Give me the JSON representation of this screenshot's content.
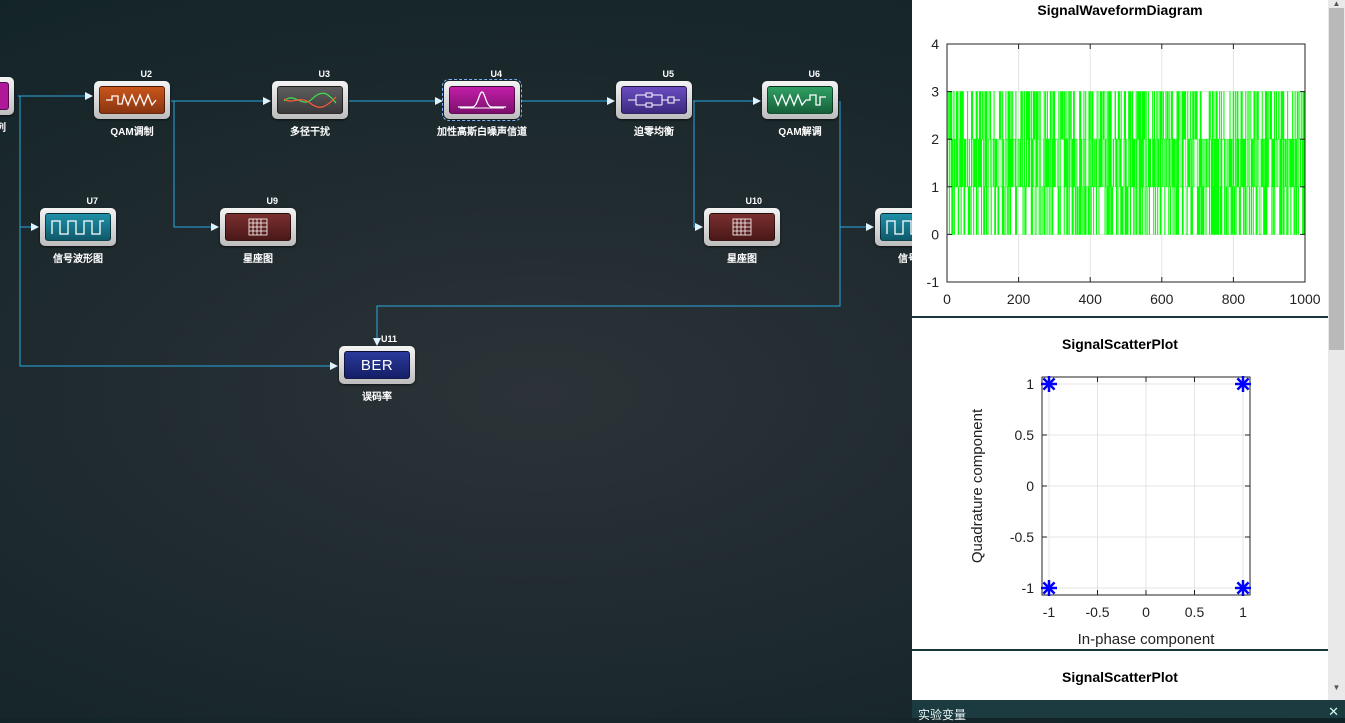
{
  "canvas": {
    "blocks": [
      {
        "id": "U2",
        "label": "QAM调制"
      },
      {
        "id": "U3",
        "label": "多径干扰"
      },
      {
        "id": "U4",
        "label": "加性高斯白噪声信道"
      },
      {
        "id": "U5",
        "label": "迫零均衡"
      },
      {
        "id": "U6",
        "label": "QAM解调"
      },
      {
        "id": "U7",
        "label": "信号波形图"
      },
      {
        "id": "U9",
        "label": "星座图"
      },
      {
        "id": "U10",
        "label": "星座图"
      },
      {
        "id": "U11",
        "label": "误码率",
        "screen_text": "BER"
      }
    ],
    "partial_left_label": "序列",
    "partial_right_label": "信号波"
  },
  "panel": {
    "plot1_title": "SignalWaveformDiagram",
    "plot2_title": "SignalScatterPlot",
    "plot3_title": "SignalScatterPlot"
  },
  "bottom_bar": {
    "title": "实验变量",
    "close_glyph": "✕"
  },
  "colors": {
    "waveform": "#00ff00",
    "scatter": "#0000ff",
    "wire": "#2aa8e0"
  },
  "chart_data": [
    {
      "type": "line",
      "title": "SignalWaveformDiagram",
      "xlabel": "",
      "ylabel": "",
      "xlim": [
        0,
        1000
      ],
      "ylim": [
        -1,
        4
      ],
      "xticks": [
        0,
        200,
        400,
        600,
        800,
        1000
      ],
      "yticks": [
        -1,
        0,
        1,
        2,
        3,
        4
      ],
      "series": [
        {
          "values_description_free": true,
          "levels": [
            0,
            1,
            2,
            3
          ],
          "length": 1000
        }
      ]
    },
    {
      "type": "scatter",
      "title": "SignalScatterPlot",
      "xlabel": "In-phase component",
      "ylabel": "Quadrature component",
      "xlim": [
        -1,
        1
      ],
      "ylim": [
        -1,
        1
      ],
      "xticks": [
        -1,
        -0.5,
        0,
        0.5,
        1
      ],
      "yticks": [
        -1,
        -0.5,
        0,
        0.5,
        1
      ],
      "points": [
        [
          -1,
          1
        ],
        [
          1,
          1
        ],
        [
          -1,
          -1
        ],
        [
          1,
          -1
        ]
      ]
    }
  ]
}
